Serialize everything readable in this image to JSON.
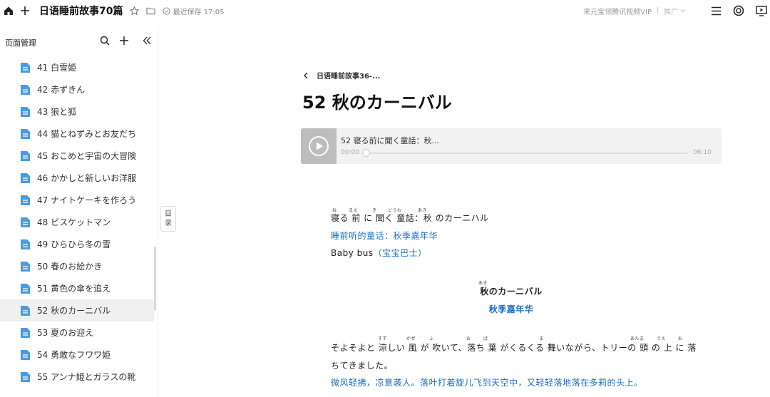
{
  "topbar": {
    "doc_title": "日语睡前故事70篇",
    "saved_text": "最近保存 17:05",
    "vip_text": "来元宝领腾讯视频VIP",
    "promo_text": "推广"
  },
  "sidebar": {
    "title": "页面管理",
    "items": [
      {
        "label": "41 白雪姫"
      },
      {
        "label": "42 赤ずきん"
      },
      {
        "label": "43 狼と狐"
      },
      {
        "label": "44 猫とねずみとお友だち"
      },
      {
        "label": "45 おこめと宇宙の大冒険"
      },
      {
        "label": "46 かかしと新しいお洋服"
      },
      {
        "label": "47 ナイトケーキを作ろう"
      },
      {
        "label": "48 ビスケットマン"
      },
      {
        "label": "49 ひらひら冬の雪"
      },
      {
        "label": "50 春のお絵かき"
      },
      {
        "label": "51 黄色の傘を追え"
      },
      {
        "label": "52 秋のカーニバル"
      },
      {
        "label": "53 夏のお迎え"
      },
      {
        "label": "54 勇敢なフワワ姫"
      },
      {
        "label": "55 アンナ姫とガラスの靴"
      }
    ],
    "active_index": 11
  },
  "toc_tab": {
    "line1": "目",
    "line2": "录"
  },
  "main": {
    "breadcrumb": "日语睡前故事36-...",
    "title": "52 秋のカーニバル",
    "audio": {
      "title": "52 寝る前に聞く童話：秋...",
      "current": "00:00",
      "duration": "06:10",
      "progress": 0
    },
    "content": {
      "line1": "寝る 前 に 聞く 童話：秋 のカーニハル",
      "line1_ruby": [
        "ね",
        "まえ",
        "き",
        "どうわ",
        "あき"
      ],
      "line2": "睡前听的童话：秋季嘉年华",
      "line3_a": "Baby bus",
      "line3_b": "（宝宝巴士）",
      "heading_jp": "秋のカーニバル",
      "heading_ruby": "あき",
      "heading_cn": "秋季嘉年华",
      "para1_a": "そよそよと 涼しい 風 が 吹いて、落ち 葉 がくるくる 舞いながら、トリーの 頭 の 上 に 落",
      "para1_ruby": [
        "すず",
        "かぜ",
        "ふ",
        "お",
        "ば",
        "ま",
        "あたま",
        "うえ",
        "お"
      ],
      "para1_b": "ちてきました。",
      "para1_cn": "微风轻拂，凉意袭人。落叶打着旋儿飞到天空中，又轻轻落地落在多莉的头上。"
    }
  },
  "colors": {
    "accent": "#1a6fc4",
    "file_icon": "#4a9be0",
    "active_bg": "#f0f0f0"
  }
}
